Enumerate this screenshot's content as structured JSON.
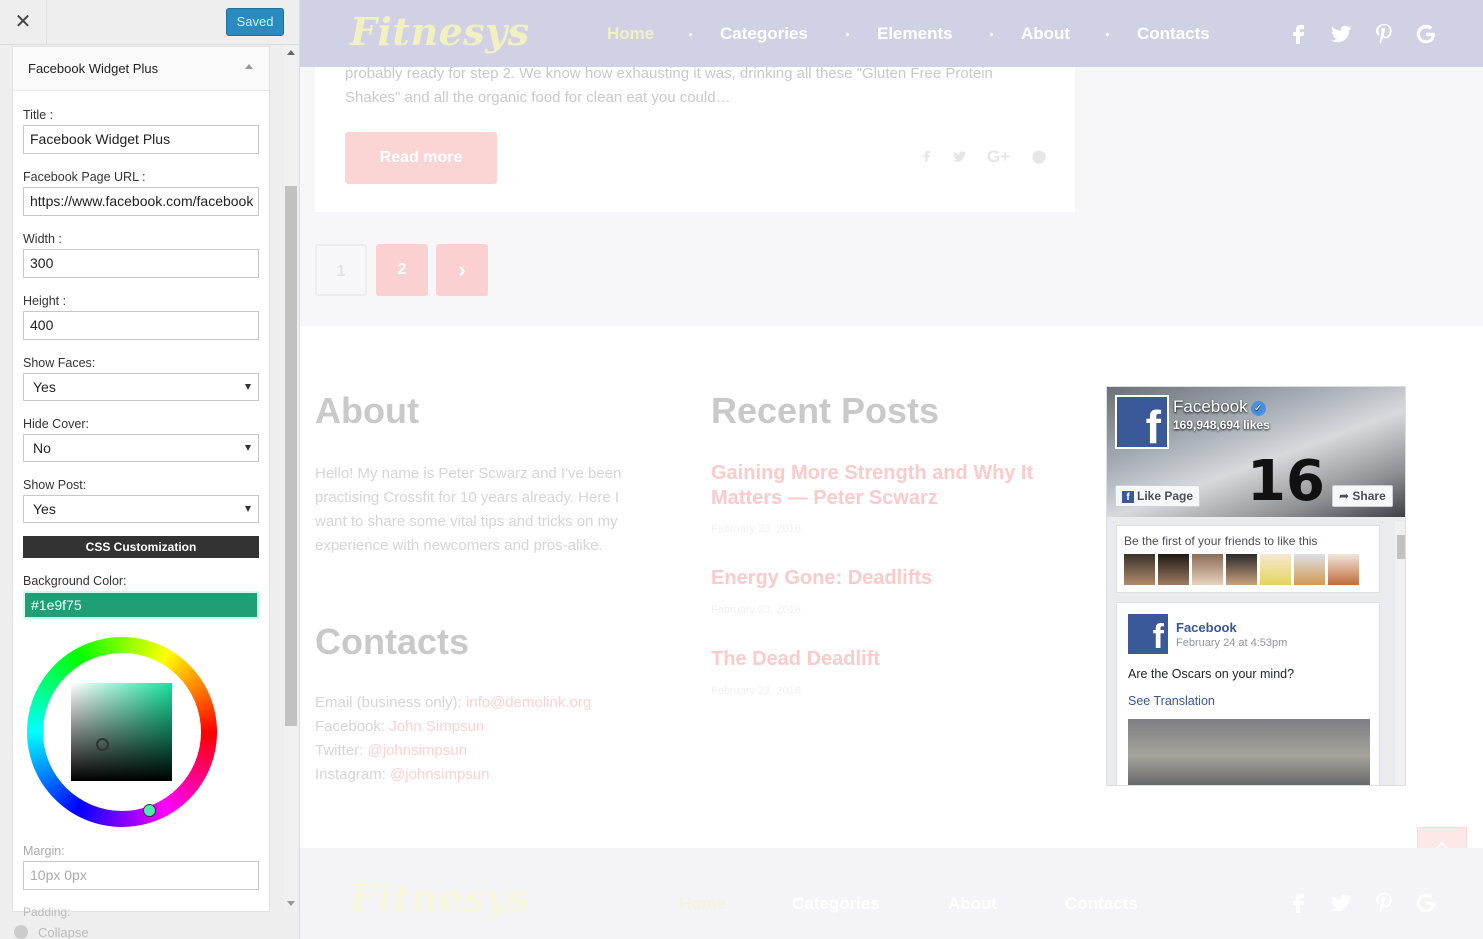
{
  "sidebar": {
    "close_icon": "close-icon",
    "saved_label": "Saved",
    "widget_title": "Facebook Widget Plus",
    "fields": {
      "title_label": "Title :",
      "title_value": "Facebook Widget Plus",
      "url_label": "Facebook Page URL :",
      "url_value": "https://www.facebook.com/facebook",
      "width_label": "Width :",
      "width_value": "300",
      "height_label": "Height :",
      "height_value": "400",
      "faces_label": "Show Faces:",
      "faces_value": "Yes",
      "cover_label": "Hide Cover:",
      "cover_value": "No",
      "post_label": "Show Post:",
      "post_value": "Yes",
      "css_label": "CSS Customization",
      "bg_label": "Background Color:",
      "bg_value": "#1e9f75",
      "margin_label": "Margin:",
      "margin_placeholder": "10px 0px",
      "padding_label": "Padding:"
    },
    "collapse_label": "Collapse"
  },
  "site": {
    "logo": "Fitnesys",
    "nav": [
      "Home",
      "Categories",
      "Elements",
      "About",
      "Contacts"
    ],
    "social_icons": [
      "facebook-icon",
      "twitter-icon",
      "pinterest-icon",
      "google-icon"
    ],
    "post_excerpt": "probably ready for step 2. We know how exhausting it was, drinking all these \"Gluten Free Protein Shakes\" and all the organic food for clean eat you could…",
    "read_more": "Read more",
    "pagination": [
      "1",
      "2",
      "›"
    ],
    "about_heading": "About",
    "about_text": "Hello! My name is Peter Scwarz and I've been practising Crossfit for 10 years already. Here I want to share some vital tips and tricks on my experience with newcomers and pros-alike.",
    "contacts_heading": "Contacts",
    "contacts": [
      {
        "label": "Email (business only): ",
        "value": "info@demolink.org"
      },
      {
        "label": "Facebook: ",
        "value": "John Simpsun"
      },
      {
        "label": "Twitter: ",
        "value": "@johnsimpsun"
      },
      {
        "label": "Instagram: ",
        "value": "@johnsimpsun"
      }
    ],
    "recent_heading": "Recent Posts",
    "recent_posts": [
      {
        "title": "Gaining More Strength and Why It Matters — Peter Scwarz",
        "date": "February 23, 2016"
      },
      {
        "title": "Energy Gone: Deadlifts",
        "date": "February 23, 2016"
      },
      {
        "title": "The Dead Deadlift",
        "date": "February 23, 2016"
      }
    ],
    "footer_nav": [
      "Home",
      "Categories",
      "About",
      "Contacts"
    ]
  },
  "facebook": {
    "page_name": "Facebook",
    "likes": "169,948,694 likes",
    "like_page": "Like Page",
    "share": "Share",
    "friends_text": "Be the first of your friends to like this",
    "post_author": "Facebook",
    "post_date": "February 24 at 4:53pm",
    "post_text": "Are the Oscars on your mind?",
    "see_translation": "See Translation"
  }
}
